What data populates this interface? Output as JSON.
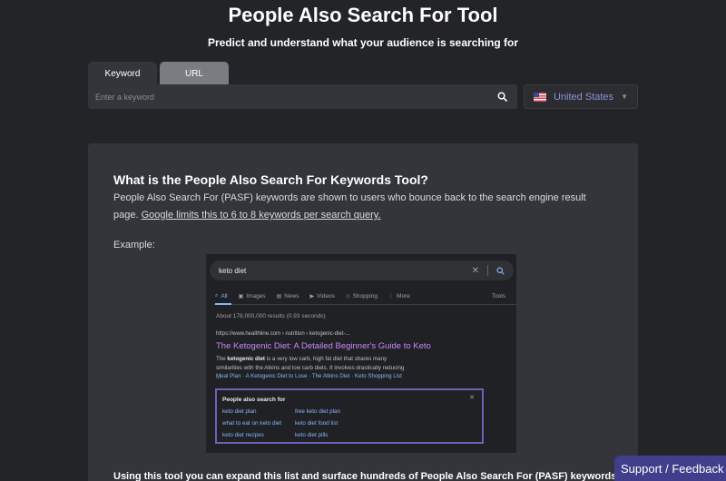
{
  "header": {
    "title": "People Also Search For Tool",
    "subtitle": "Predict and understand what your audience is searching for"
  },
  "tabs": [
    {
      "label": "Keyword",
      "active": true
    },
    {
      "label": "URL",
      "active": false
    }
  ],
  "search": {
    "placeholder": "Enter a keyword",
    "value": "",
    "icon": "search-icon"
  },
  "country": {
    "selected": "United States",
    "flag": "us-flag-icon"
  },
  "panel": {
    "heading": "What is the People Also Search For Keywords Tool?",
    "text": "People Also Search For (PASF) keywords are shown to users who bounce back to the search engine result page. ",
    "link": "Google limits this to 6 to 8 keywords per search query.",
    "example_label": "Example:",
    "bottom_text": "Using this tool you can expand this list and surface hundreds of People Also Search For (PASF) keywords"
  },
  "example": {
    "query": "keto diet",
    "tabs": [
      "All",
      "Images",
      "News",
      "Videos",
      "Shopping",
      "More"
    ],
    "tools": "Tools",
    "stats": "About 178,000,000 results (0.93 seconds)",
    "url": "https://www.healthline.com › nutrition › ketogenic-diet-...",
    "result_title": "The Ketogenic Diet: A Detailed Beginner's Guide to Keto",
    "snippet_pre": "The ",
    "snippet_bold": "ketogenic diet",
    "snippet_post": " is a very low carb, high fat diet that shares many similarities with the Atkins and low carb diets. It involves drastically reducing ...",
    "sitelinks": "Meal Plan · A Ketogenic Diet to Lose · The Atkins Diet · Keto Shopping List",
    "pasf_title": "People also search for",
    "pasf_items": [
      "keto diet plan",
      "free keto diet plan",
      "what to eat on keto diet",
      "keto diet food list",
      "keto diet recipes",
      "keto diet pills"
    ]
  },
  "support": {
    "label": "Support / Feedback"
  },
  "colors": {
    "background": "#232427",
    "panel": "#33353a",
    "accent": "#413f8c",
    "link_purple": "#c58af9",
    "link_blue": "#8ab4f8"
  }
}
